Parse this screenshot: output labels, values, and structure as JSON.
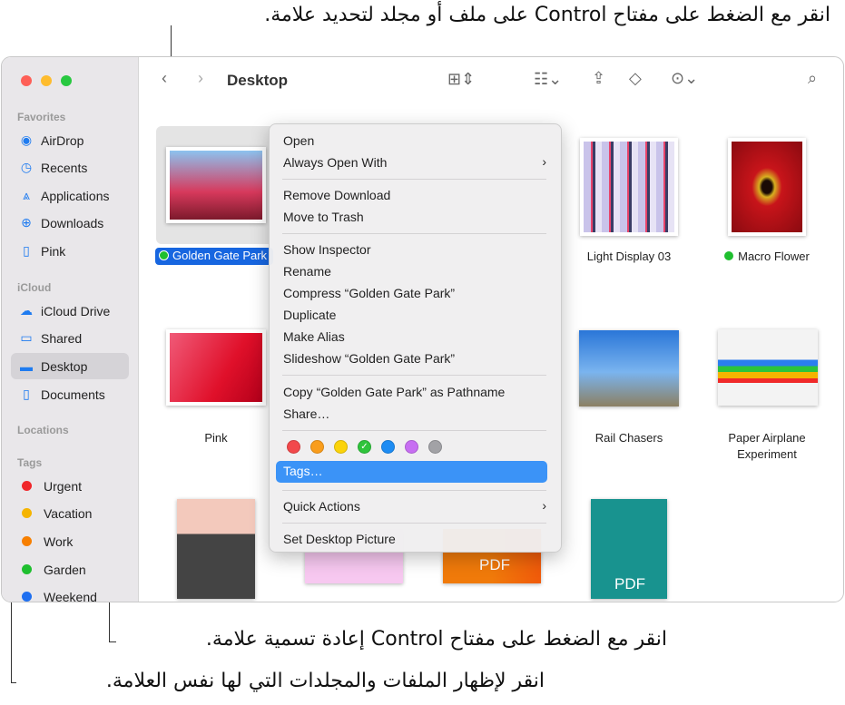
{
  "annotations": {
    "top": "انقر مع الضغط على مفتاح Control على ملف أو مجلد لتحديد علامة.",
    "rename": "انقر مع الضغط على مفتاح Control إعادة تسمية علامة.",
    "show": "انقر لإظهار الملفات والمجلدات التي لها نفس العلامة."
  },
  "sidebar": {
    "favorites_header": "Favorites",
    "favorites": [
      {
        "label": "AirDrop",
        "icon": "airdrop-icon"
      },
      {
        "label": "Recents",
        "icon": "clock-icon"
      },
      {
        "label": "Applications",
        "icon": "applications-icon"
      },
      {
        "label": "Downloads",
        "icon": "download-icon"
      },
      {
        "label": "Pink",
        "icon": "document-icon"
      }
    ],
    "icloud_header": "iCloud",
    "icloud": [
      {
        "label": "iCloud Drive",
        "icon": "cloud-icon"
      },
      {
        "label": "Shared",
        "icon": "shared-folder-icon"
      },
      {
        "label": "Desktop",
        "icon": "desktop-icon",
        "selected": true
      },
      {
        "label": "Documents",
        "icon": "document-icon"
      }
    ],
    "locations_header": "Locations",
    "tags_header": "Tags",
    "tags": [
      {
        "label": "Urgent",
        "color": "#f0262a"
      },
      {
        "label": "Vacation",
        "color": "#f5b400"
      },
      {
        "label": "Work",
        "color": "#f77f00"
      },
      {
        "label": "Garden",
        "color": "#1fbf2f"
      },
      {
        "label": "Weekend",
        "color": "#1e6ff0"
      }
    ]
  },
  "toolbar": {
    "title": "Desktop"
  },
  "files": [
    {
      "name": "Golden Gate Park",
      "tag": "#1fbf2f",
      "selected": true
    },
    {
      "name": "Light Display 03"
    },
    {
      "name": "Macro Flower",
      "tag": "#1fbf2f"
    },
    {
      "name": "Pink"
    },
    {
      "name": "Rail Chasers"
    },
    {
      "name": "Paper Airplane Experiment"
    },
    {
      "name": "PDF"
    },
    {
      "name": "PDF"
    }
  ],
  "menu": {
    "items": [
      "Open",
      "Always Open With",
      "Remove Download",
      "Move to Trash",
      "Show Inspector",
      "Rename",
      "Compress “Golden Gate Park”",
      "Duplicate",
      "Make Alias",
      "Slideshow “Golden Gate Park”",
      "Copy “Golden Gate Park” as Pathname",
      "Share…",
      "Tags…",
      "Quick Actions",
      "Set Desktop Picture"
    ],
    "tag_colors": [
      "#f2484b",
      "#f99d1c",
      "#fbd30a",
      "#2fc43c",
      "#1d8cf3",
      "#c76ef2",
      "#a2a2a6"
    ],
    "checked_tag": 3,
    "highlight": "#3b93f7"
  }
}
